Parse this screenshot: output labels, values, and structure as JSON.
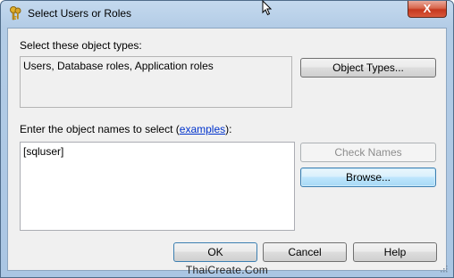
{
  "window": {
    "title": "Select Users or Roles",
    "close_glyph": "X"
  },
  "object_types": {
    "label": "Select these object types:",
    "value": "Users, Database roles, Application roles",
    "button": "Object Types..."
  },
  "object_names": {
    "label_prefix": "Enter the object names to select (",
    "link": "examples",
    "label_suffix": "):",
    "value": "[sqluser]",
    "check_names_button": "Check Names",
    "browse_button": "Browse..."
  },
  "buttons": {
    "ok": "OK",
    "cancel": "Cancel",
    "help": "Help"
  },
  "footer": {
    "watermark": "ThaiCreate.Com"
  },
  "icons": [
    "keys-icon",
    "close-icon",
    "mouse-cursor-icon",
    "resize-grip-icon"
  ]
}
